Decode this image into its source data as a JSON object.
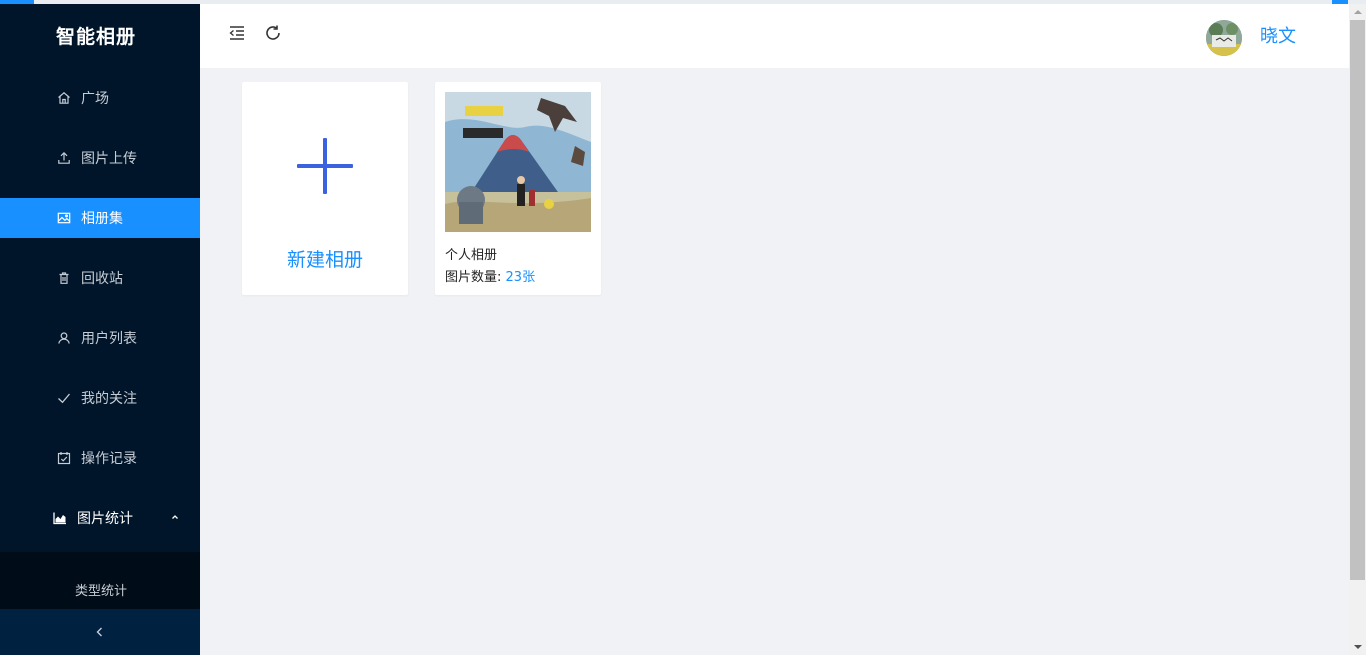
{
  "app": {
    "title": "智能相册"
  },
  "sidebar": {
    "items": [
      {
        "label": "广场",
        "icon": "home-icon"
      },
      {
        "label": "图片上传",
        "icon": "upload-icon"
      },
      {
        "label": "相册集",
        "icon": "image-icon",
        "active": true
      },
      {
        "label": "回收站",
        "icon": "trash-icon"
      },
      {
        "label": "用户列表",
        "icon": "user-icon"
      },
      {
        "label": "我的关注",
        "icon": "check-icon"
      },
      {
        "label": "操作记录",
        "icon": "calendar-check-icon"
      }
    ],
    "stats": {
      "label": "图片统计",
      "icon": "area-chart-icon",
      "expanded": true,
      "sub_items": [
        {
          "label": "类型统计"
        }
      ]
    }
  },
  "header": {
    "username": "晓文"
  },
  "main": {
    "new_album_label": "新建相册",
    "albums": [
      {
        "name": "个人相册",
        "count_label": "图片数量:",
        "count_value": "23张"
      }
    ]
  },
  "colors": {
    "sidebar_bg": "#001529",
    "accent": "#1890ff",
    "page_bg": "#f0f2f5"
  }
}
